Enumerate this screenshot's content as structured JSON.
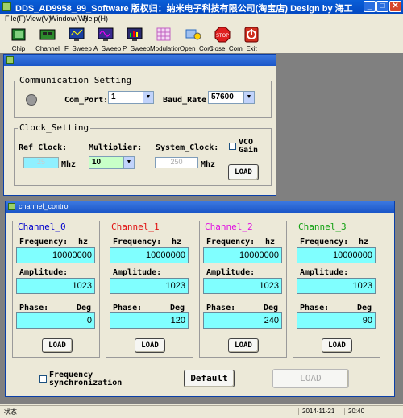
{
  "app": {
    "title": "DDS_AD9958_99_Software   版权归：纳米电子科技有限公司(淘宝店)   Design by 海工",
    "min_label": "_",
    "max_label": "□",
    "close_label": "✕"
  },
  "menu": [
    "File(F)",
    "View(V)",
    "Window(W)",
    "Help(H)"
  ],
  "toolbar": [
    {
      "label": "Chip",
      "icon": "chip-icon",
      "color": "#1d7a2b"
    },
    {
      "label": "Channel",
      "icon": "circuit-board-icon",
      "color": "#2d8a2d"
    },
    {
      "label": "F_Sweep",
      "icon": "monitor-icon",
      "color": "#1a3fa0"
    },
    {
      "label": "A_Sweep",
      "icon": "monitor-waveform-icon",
      "color": "#5a2fa0"
    },
    {
      "label": "P_Sweep",
      "icon": "monitor-bars-icon",
      "color": "#7a2a8a"
    },
    {
      "label": "Modulation",
      "icon": "grid-chart-icon",
      "color": "#c060c0"
    },
    {
      "label": "Open_Com",
      "icon": "open-port-icon",
      "color": "#2a6ac0"
    },
    {
      "label": "Close_Com",
      "icon": "stop-sign-icon",
      "color": "#e02020"
    },
    {
      "label": "Exit",
      "icon": "exit-icon",
      "color": "#d03020"
    }
  ],
  "settings": {
    "communication_title": "Communication_Setting",
    "com_port_label": "Com_Port:",
    "com_port_value": "1",
    "baud_rate_label": "Baud_Rate:",
    "baud_rate_value": "57600",
    "clock_title": "Clock_Setting",
    "ref_clock_label": "Ref Clock:",
    "ref_clock_value": "25",
    "ref_clock_unit": "Mhz",
    "multiplier_label": "Multiplier:",
    "multiplier_value": "10",
    "system_clock_label": "System_Clock:",
    "system_clock_value": "250",
    "system_clock_unit": "Mhz",
    "vco_label": "VCO Gain",
    "load_label": "LOAD"
  },
  "channel_window": {
    "title": "channel_control",
    "frequency_sync_label": "Frequency synchronization",
    "default_label": "Default",
    "load_all_label": "LOAD"
  },
  "channels": [
    {
      "name": "Channel_0",
      "color": "#0000cc",
      "freq_label": "Frequency:",
      "freq_unit": "hz",
      "freq": "10000000",
      "amp_label": "Amplitude:",
      "amp": "1023",
      "phase_label": "Phase:",
      "phase_unit": "Deg",
      "phase": "0",
      "load": "LOAD"
    },
    {
      "name": "Channel_1",
      "color": "#e01010",
      "freq_label": "Frequency:",
      "freq_unit": "hz",
      "freq": "10000000",
      "amp_label": "Amplitude:",
      "amp": "1023",
      "phase_label": "Phase:",
      "phase_unit": "Deg",
      "phase": "120",
      "load": "LOAD"
    },
    {
      "name": "Channel_2",
      "color": "#e010e0",
      "freq_label": "Frequency:",
      "freq_unit": "hz",
      "freq": "10000000",
      "amp_label": "Amplitude:",
      "amp": "1023",
      "phase_label": "Phase:",
      "phase_unit": "Deg",
      "phase": "240",
      "load": "LOAD"
    },
    {
      "name": "Channel_3",
      "color": "#10a010",
      "freq_label": "Frequency:",
      "freq_unit": "hz",
      "freq": "10000000",
      "amp_label": "Amplitude:",
      "amp": "1023",
      "phase_label": "Phase:",
      "phase_unit": "Deg",
      "phase": "90",
      "load": "LOAD"
    }
  ],
  "status": {
    "text": "状态",
    "date": "2014-11-21",
    "time": "20:40"
  }
}
